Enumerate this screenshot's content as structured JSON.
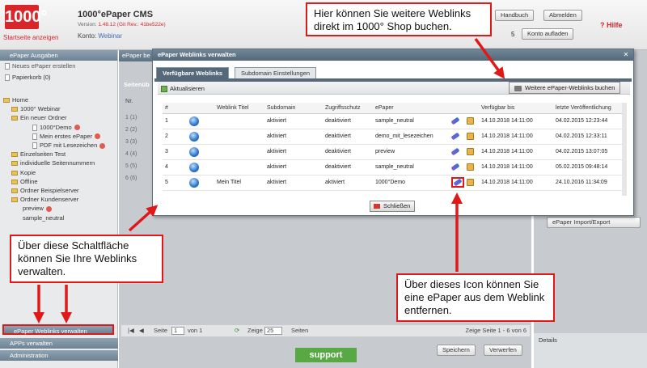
{
  "header": {
    "logo": "1000°",
    "home_link": "Startseite anzeigen",
    "app_title": "1000°ePaper CMS",
    "version_label": "Version:",
    "version_value": "1.48.12 (Git Rev.: 41be522e)",
    "konto_label": "Konto:",
    "konto_value": "Webinar",
    "btn_handbuch": "Handbuch",
    "btn_abmelden": "Abmelden",
    "count_suffix": "5",
    "btn_konto": "Konto aufladen",
    "hilfe": "? Hilfe"
  },
  "sidebar": {
    "head": "ePaper Ausgaben",
    "new_epaper": "Neues ePaper erstellen",
    "trash": "Papierkorb (0)",
    "tree": [
      "Home",
      "1000° Webinar",
      "Ein neuer Ordner",
      "1000°Demo",
      "Mein erstes ePaper",
      "PDF mit Lesezeichen",
      "Einzelseiten Test",
      "individuelle Seitennummern",
      "Kopie",
      "Offline",
      "Ordner Beispielserver",
      "Ordner Kundenserver",
      "preview",
      "sample_neutral"
    ],
    "bottom_items": [
      "ePaper Weblinks verwalten",
      "APPs verwalten",
      "Administration"
    ]
  },
  "main": {
    "bg_title": "ePaper be",
    "bg_sub": "Seitenüb",
    "bg_col": "Nr.",
    "bg_rows": [
      "1 (1)",
      "2 (2)",
      "3 (3)",
      "4 (4)",
      "5 (5)",
      "6 (6)"
    ],
    "import_export": "ePaper Import/Export",
    "details": "Details",
    "pager": {
      "seite": "Seite",
      "page": "1",
      "of": "von 1",
      "zeige": "Zeige",
      "per": "25",
      "seiten": "Seiten",
      "summary": "Zeige Seite 1 - 6 von 6"
    },
    "btn_speichern": "Speichern",
    "btn_verwerfen": "Verwerfen",
    "support": "support"
  },
  "modal": {
    "title": "ePaper Weblinks verwalten",
    "tabs": [
      "Verfügbare Weblinks",
      "Subdomain Einstellungen"
    ],
    "refresh": "Aktualisieren",
    "buy_btn": "Weitere ePaper-Weblinks buchen",
    "columns": [
      "#",
      "",
      "Weblink Titel",
      "Subdomain",
      "Zugriffsschutz",
      "ePaper",
      "",
      "",
      "Verfügbar bis",
      "letzte Veröffentlichung"
    ],
    "rows": [
      {
        "n": "1",
        "title": "",
        "sub": "aktiviert",
        "zugriff": "deaktiviert",
        "epaper": "sample_neutral",
        "until": "14.10.2018 14:11:00",
        "last": "04.02.2015 12:23:44"
      },
      {
        "n": "2",
        "title": "",
        "sub": "aktiviert",
        "zugriff": "deaktiviert",
        "epaper": "demo_mit_lesezeichen",
        "until": "14.10.2018 14:11:00",
        "last": "04.02.2015 12:33:11"
      },
      {
        "n": "3",
        "title": "",
        "sub": "aktiviert",
        "zugriff": "deaktiviert",
        "epaper": "preview",
        "until": "14.10.2018 14:11:00",
        "last": "04.02.2015 13:07:05"
      },
      {
        "n": "4",
        "title": "",
        "sub": "aktiviert",
        "zugriff": "deaktiviert",
        "epaper": "sample_neutral",
        "until": "14.10.2018 14:11:00",
        "last": "05.02.2015 09:48:14"
      },
      {
        "n": "5",
        "title": "Mein Titel",
        "sub": "aktiviert",
        "zugriff": "aktiviert",
        "epaper": "1000°Demo",
        "until": "14.10.2018 14:11:00",
        "last": "24.10.2016 11:34:09"
      }
    ],
    "close_btn": "Schließen"
  },
  "callouts": {
    "top": "Hier können Sie weitere Weblinks direkt im 1000° Shop buchen.",
    "left": "Über diese Schaltfläche können Sie Ihre Weblinks verwalten.",
    "bottom": "Über dieses Icon können Sie eine ePaper aus dem Weblink entfernen."
  },
  "colors": {
    "accent": "#d8262b",
    "callout_border": "#e11818",
    "support": "#58a843"
  }
}
